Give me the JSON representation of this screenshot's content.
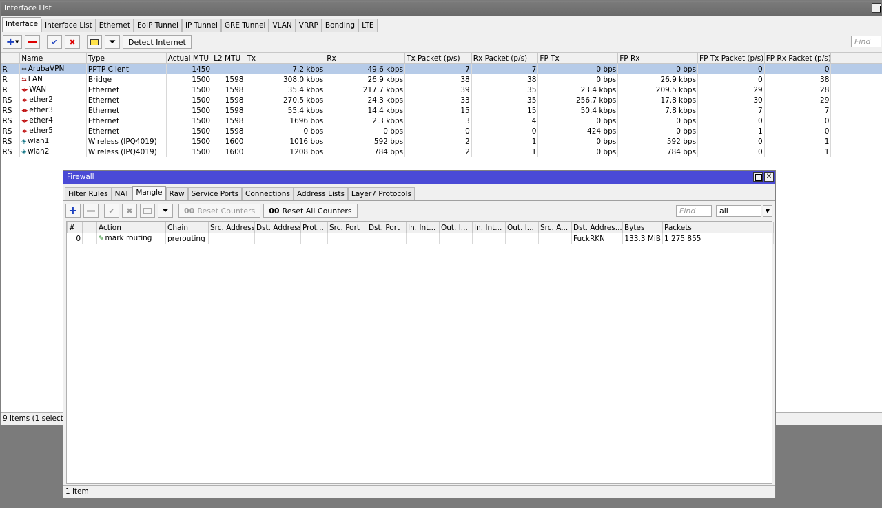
{
  "iface": {
    "title": "Interface List",
    "tabs": [
      "Interface",
      "Interface List",
      "Ethernet",
      "EoIP Tunnel",
      "IP Tunnel",
      "GRE Tunnel",
      "VLAN",
      "VRRP",
      "Bonding",
      "LTE"
    ],
    "detect_label": "Detect Internet",
    "find_placeholder": "Find",
    "columns": [
      "",
      "Name",
      "Type",
      "Actual MTU",
      "L2 MTU",
      "Tx",
      "Rx",
      "Tx Packet (p/s)",
      "Rx Packet (p/s)",
      "FP Tx",
      "FP Rx",
      "FP Tx Packet (p/s)",
      "FP Rx Packet (p/s)"
    ],
    "rows": [
      {
        "flag": "R",
        "icon": "vpn",
        "name": "ArubaVPN",
        "type": "PPTP Client",
        "mtu": "1450",
        "l2mtu": "",
        "tx": "7.2 kbps",
        "rx": "49.6 kbps",
        "txp": "7",
        "rxp": "7",
        "fptx": "0 bps",
        "fprx": "0 bps",
        "fptxp": "0",
        "fprxp": "0",
        "selected": true
      },
      {
        "flag": "R",
        "icon": "bridge",
        "name": "LAN",
        "type": "Bridge",
        "mtu": "1500",
        "l2mtu": "1598",
        "tx": "308.0 kbps",
        "rx": "26.9 kbps",
        "txp": "38",
        "rxp": "38",
        "fptx": "0 bps",
        "fprx": "26.9 kbps",
        "fptxp": "0",
        "fprxp": "38"
      },
      {
        "flag": "R",
        "icon": "eth",
        "name": "WAN",
        "type": "Ethernet",
        "mtu": "1500",
        "l2mtu": "1598",
        "tx": "35.4 kbps",
        "rx": "217.7 kbps",
        "txp": "39",
        "rxp": "35",
        "fptx": "23.4 kbps",
        "fprx": "209.5 kbps",
        "fptxp": "29",
        "fprxp": "28"
      },
      {
        "flag": "RS",
        "icon": "eth",
        "name": "ether2",
        "type": "Ethernet",
        "mtu": "1500",
        "l2mtu": "1598",
        "tx": "270.5 kbps",
        "rx": "24.3 kbps",
        "txp": "33",
        "rxp": "35",
        "fptx": "256.7 kbps",
        "fprx": "17.8 kbps",
        "fptxp": "30",
        "fprxp": "29"
      },
      {
        "flag": "RS",
        "icon": "eth",
        "name": "ether3",
        "type": "Ethernet",
        "mtu": "1500",
        "l2mtu": "1598",
        "tx": "55.4 kbps",
        "rx": "14.4 kbps",
        "txp": "15",
        "rxp": "15",
        "fptx": "50.4 kbps",
        "fprx": "7.8 kbps",
        "fptxp": "7",
        "fprxp": "7"
      },
      {
        "flag": "RS",
        "icon": "eth",
        "name": "ether4",
        "type": "Ethernet",
        "mtu": "1500",
        "l2mtu": "1598",
        "tx": "1696 bps",
        "rx": "2.3 kbps",
        "txp": "3",
        "rxp": "4",
        "fptx": "0 bps",
        "fprx": "0 bps",
        "fptxp": "0",
        "fprxp": "0"
      },
      {
        "flag": "RS",
        "icon": "eth",
        "name": "ether5",
        "type": "Ethernet",
        "mtu": "1500",
        "l2mtu": "1598",
        "tx": "0 bps",
        "rx": "0 bps",
        "txp": "0",
        "rxp": "0",
        "fptx": "424 bps",
        "fprx": "0 bps",
        "fptxp": "1",
        "fprxp": "0"
      },
      {
        "flag": "RS",
        "icon": "wlan",
        "name": "wlan1",
        "type": "Wireless (IPQ4019)",
        "mtu": "1500",
        "l2mtu": "1600",
        "tx": "1016 bps",
        "rx": "592 bps",
        "txp": "2",
        "rxp": "1",
        "fptx": "0 bps",
        "fprx": "592 bps",
        "fptxp": "0",
        "fprxp": "1"
      },
      {
        "flag": "RS",
        "icon": "wlan",
        "name": "wlan2",
        "type": "Wireless (IPQ4019)",
        "mtu": "1500",
        "l2mtu": "1600",
        "tx": "1208 bps",
        "rx": "784 bps",
        "txp": "2",
        "rxp": "1",
        "fptx": "0 bps",
        "fprx": "784 bps",
        "fptxp": "0",
        "fprxp": "1"
      }
    ],
    "status": "9 items (1 selected)"
  },
  "fw": {
    "title": "Firewall",
    "tabs": [
      "Filter Rules",
      "NAT",
      "Mangle",
      "Raw",
      "Service Ports",
      "Connections",
      "Address Lists",
      "Layer7 Protocols"
    ],
    "active_tab": "Mangle",
    "reset_counters": "Reset Counters",
    "reset_all_counters": "Reset All Counters",
    "find_placeholder": "Find",
    "filter_value": "all",
    "columns": [
      "#",
      "",
      "Action",
      "Chain",
      "Src. Address",
      "Dst. Address",
      "Prot...",
      "Src. Port",
      "Dst. Port",
      "In. Int...",
      "Out. I...",
      "In. Int...",
      "Out. I...",
      "Src. A...",
      "Dst. Addres...",
      "Bytes",
      "Packets"
    ],
    "rows": [
      {
        "num": "0",
        "action": "mark routing",
        "chain": "prerouting",
        "dst_list": "FuckRKN",
        "bytes": "133.3 MiB",
        "packets": "1 275 855"
      }
    ],
    "status": "1 item"
  }
}
